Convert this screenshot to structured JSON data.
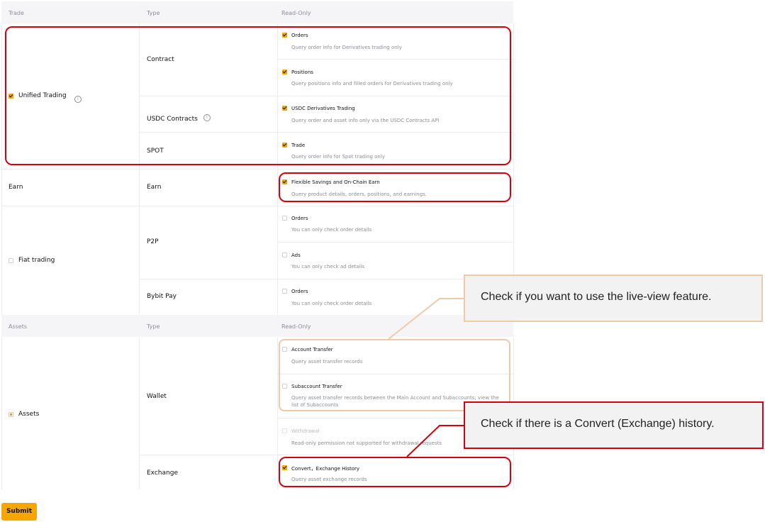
{
  "table": {
    "header": {
      "col1": "Trade",
      "col2": "Type",
      "col3": "Read-Only"
    },
    "header2": {
      "col1": "Assets",
      "col2": "Type",
      "col3": "Read-Only"
    },
    "groups": {
      "unified": {
        "label": "Unified Trading",
        "contract": {
          "type": "Contract",
          "perms": [
            {
              "title": "Orders",
              "desc": "Query order info for Derivatives trading only"
            },
            {
              "title": "Positions",
              "desc": "Query positions info and filled orders for Derivatives trading only"
            }
          ]
        },
        "usdc": {
          "type": "USDC Contracts",
          "perm": {
            "title": "USDC Derivatives Trading",
            "desc": "Query order and asset info only via the USDC Contracts API"
          }
        },
        "spot": {
          "type": "SPOT",
          "perm": {
            "title": "Trade",
            "desc": "Query order info for Spot trading only"
          }
        }
      },
      "earn": {
        "label": "Earn",
        "type": "Earn",
        "perm": {
          "title": "Flexible Savings and On-Chain Earn",
          "desc": "Query product details, orders, positions, and earnings."
        }
      },
      "fiat": {
        "label": "Fiat trading",
        "p2p": {
          "type": "P2P",
          "perms": [
            {
              "title": "Orders",
              "desc": "You can only check order details"
            },
            {
              "title": "Ads",
              "desc": "You can only check ad details"
            }
          ]
        },
        "bybitpay": {
          "type": "Bybit Pay",
          "perm": {
            "title": "Orders",
            "desc": "You can only check order details"
          }
        }
      },
      "assets": {
        "label": "Assets",
        "wallet": {
          "type": "Wallet",
          "perms": [
            {
              "title": "Account Transfer",
              "desc": "Query asset transfer records"
            },
            {
              "title": "Subaccount Transfer",
              "desc": "Query asset transfer records between the Main Account and Subaccounts; view the list of Subaccounts"
            },
            {
              "title": "Withdrawal",
              "desc": "Read-only permission not supported for withdrawal requests"
            }
          ]
        },
        "exchange": {
          "type": "Exchange",
          "perm": {
            "title": "Convert，Exchange History",
            "desc": "Query asset exchange records"
          }
        }
      }
    }
  },
  "callouts": {
    "live_view": "Check if you want to use the live-view feature.",
    "convert": "Check if there is a Convert (Exchange) history."
  },
  "submit_label": "Submit",
  "colors": {
    "accent": "#f7a600",
    "highlight_red": "#d7000f",
    "highlight_peach": "#f0c9a8",
    "header_bg": "#f5f5f7"
  },
  "checkbox_states": {
    "unified_trading": "checked",
    "fiat_trading": "unchecked",
    "assets": "partial"
  }
}
